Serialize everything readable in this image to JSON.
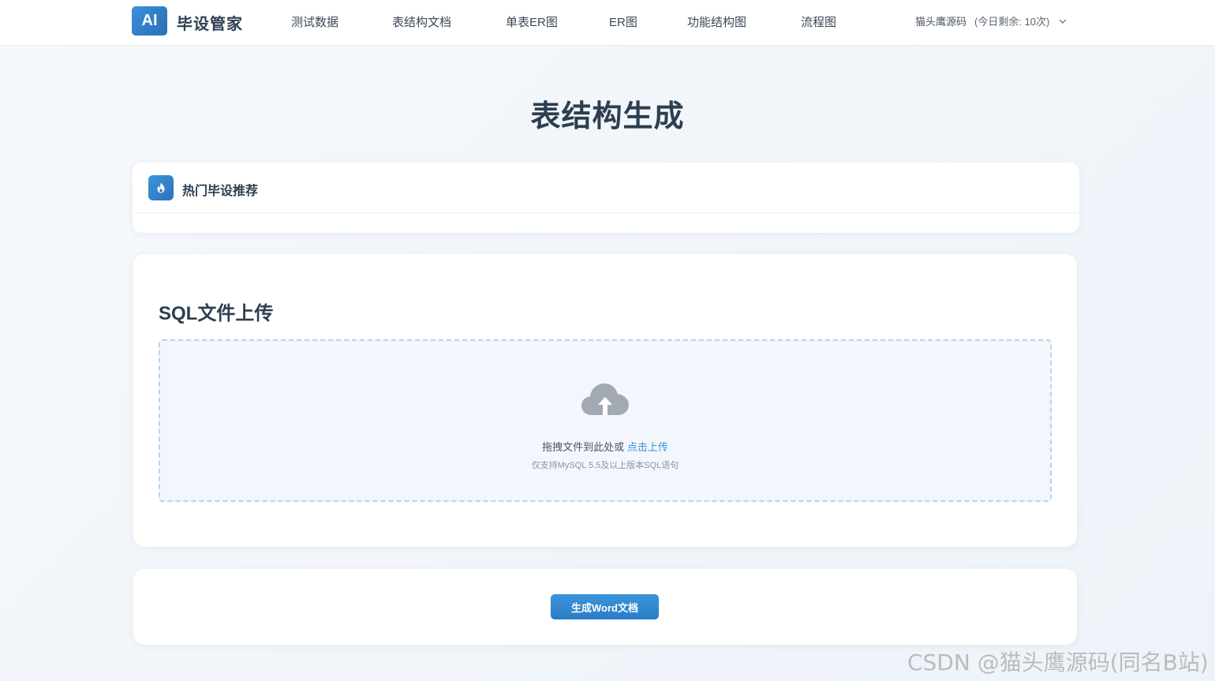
{
  "brand": {
    "badge": "AI",
    "name": "毕设管家"
  },
  "nav": {
    "items": [
      {
        "label": "测试数据"
      },
      {
        "label": "表结构文档"
      },
      {
        "label": "单表ER图"
      },
      {
        "label": "ER图"
      },
      {
        "label": "功能结构图"
      },
      {
        "label": "流程图"
      }
    ]
  },
  "user": {
    "name": "猫头鹰源码",
    "quota": "(今日剩余: 10次)",
    "icon": "chevron-down-icon"
  },
  "page": {
    "title": "表结构生成"
  },
  "hot": {
    "title": "热门毕设推荐",
    "icon": "fire-icon"
  },
  "upload": {
    "title": "SQL文件上传",
    "drop_text": "拖拽文件到此处或",
    "drop_link": "点击上传",
    "hint": "仅支持MySQL 5.5及以上版本SQL语句",
    "icon": "cloud-upload-icon"
  },
  "action": {
    "generate_label": "生成Word文档"
  },
  "watermark": "CSDN @猫头鹰源码(同名B站)",
  "colors": {
    "accent": "#3b8fd9",
    "title": "#2c3e50",
    "dropzone_bg": "#f3f7fd"
  }
}
